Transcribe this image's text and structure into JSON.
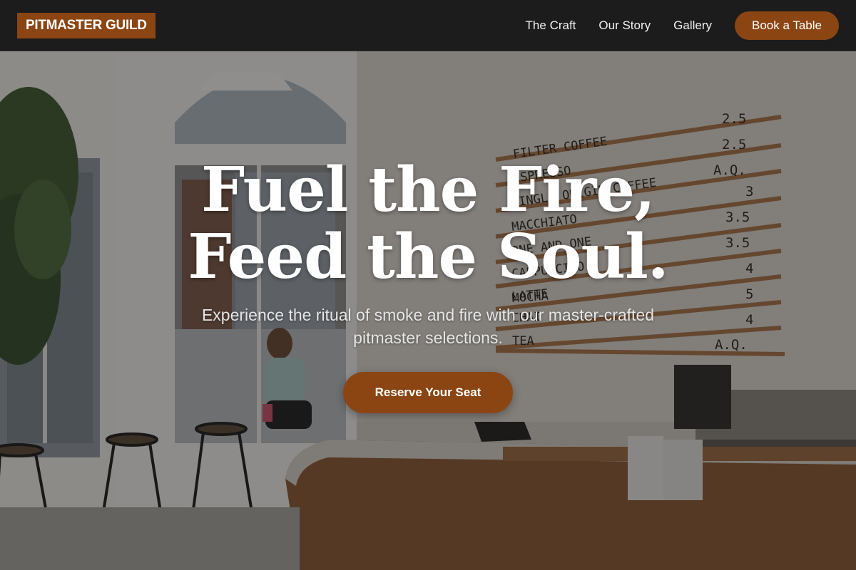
{
  "brand": {
    "name": "PITMASTER GUILD",
    "accent": "#8b4513"
  },
  "nav": {
    "links": [
      "The Craft",
      "Our Story",
      "Gallery"
    ],
    "cta": "Book a Table"
  },
  "hero": {
    "headline_line1": "Fuel the Fire,",
    "headline_line2": "Feed the Soul.",
    "subtext": "Experience the ritual of smoke and fire with our master-crafted pitmaster selections.",
    "cta": "Reserve Your Seat"
  },
  "menu_board": {
    "items": [
      {
        "name": "FILTER COFFEE",
        "price": "2.5"
      },
      {
        "name": "ESPRESSO",
        "price": "2.5"
      },
      {
        "name": "SINGLE ORIGIN COFFEE",
        "price": "A.Q."
      },
      {
        "name": "MACCHIATO",
        "price": "3"
      },
      {
        "name": "ONE AND ONE",
        "price": "3.5"
      },
      {
        "name": "CAPPUCCINO",
        "price": "3.5"
      },
      {
        "name": "LATTE",
        "price": "4"
      },
      {
        "name": "MOCHA",
        "price": "5"
      },
      {
        "name": "CHAI",
        "price": "4"
      },
      {
        "name": "TEA",
        "price": "A.Q."
      }
    ]
  }
}
